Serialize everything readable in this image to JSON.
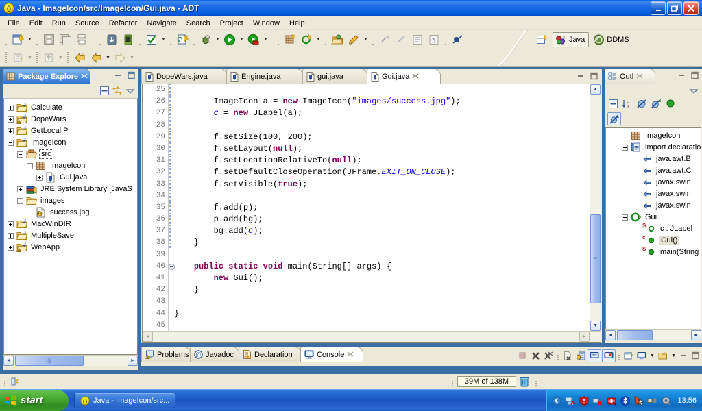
{
  "window": {
    "title": "Java - ImageIcon/src/ImageIcon/Gui.java - ADT",
    "app_icon": "eclipse-icon",
    "minimize_label": "Minimize",
    "restore_label": "Restore",
    "close_label": "Close"
  },
  "menu": [
    {
      "label": "File"
    },
    {
      "label": "Edit"
    },
    {
      "label": "Run"
    },
    {
      "label": "Source"
    },
    {
      "label": "Refactor"
    },
    {
      "label": "Navigate"
    },
    {
      "label": "Search"
    },
    {
      "label": "Project"
    },
    {
      "label": "Window"
    },
    {
      "label": "Help"
    }
  ],
  "perspective": {
    "open_label": "Open Perspective",
    "items": [
      {
        "label": "Java",
        "icon": "java-perspective-icon",
        "active": true
      },
      {
        "label": "DDMS",
        "icon": "ddms-perspective-icon",
        "active": false
      }
    ]
  },
  "package_explorer": {
    "tab_label": "Package Explore",
    "tab_icon": "package-explorer-icon",
    "toolbar": [
      {
        "name": "collapse-all-icon"
      },
      {
        "name": "link-with-editor-icon"
      },
      {
        "name": "view-menu-icon"
      }
    ],
    "tree": [
      {
        "label": "Calculate",
        "icon": "java-project-icon",
        "indent": 0,
        "expander": "plus"
      },
      {
        "label": "DopeWars",
        "icon": "java-project-warning-icon",
        "indent": 0,
        "expander": "plus"
      },
      {
        "label": "GetLocalIP",
        "icon": "java-project-icon",
        "indent": 0,
        "expander": "plus"
      },
      {
        "label": "ImageIcon",
        "icon": "java-project-icon",
        "indent": 0,
        "expander": "minus"
      },
      {
        "label": "src",
        "icon": "source-folder-icon",
        "indent": 1,
        "expander": "minus",
        "selected": true
      },
      {
        "label": "ImageIcon",
        "icon": "package-icon",
        "indent": 2,
        "expander": "minus"
      },
      {
        "label": "Gui.java",
        "icon": "java-file-icon",
        "indent": 3,
        "expander": "plus"
      },
      {
        "label": "JRE System Library [JavaS",
        "icon": "library-icon",
        "indent": 1,
        "expander": "plus"
      },
      {
        "label": "images",
        "icon": "folder-icon",
        "indent": 1,
        "expander": "minus"
      },
      {
        "label": "success.jpg",
        "icon": "image-file-icon",
        "indent": 2,
        "expander": "none"
      },
      {
        "label": "MacWinDIR",
        "icon": "java-project-icon",
        "indent": 0,
        "expander": "plus"
      },
      {
        "label": "MultipleSave",
        "icon": "java-project-icon",
        "indent": 0,
        "expander": "plus"
      },
      {
        "label": "WebApp",
        "icon": "java-project-warning-icon",
        "indent": 0,
        "expander": "plus"
      }
    ]
  },
  "editor": {
    "tabs": [
      {
        "label": "DopeWars.java",
        "icon": "java-file-icon",
        "active": false
      },
      {
        "label": "Engine.java",
        "icon": "java-file-icon",
        "active": false
      },
      {
        "label": "gui.java",
        "icon": "java-file-icon",
        "active": false
      },
      {
        "label": "Gui.java",
        "icon": "java-file-icon",
        "active": true,
        "closable": true
      }
    ],
    "first_line_number": 25,
    "last_line_number": 45,
    "lines": [
      {
        "n": 25,
        "text": "",
        "changed": true
      },
      {
        "n": 26,
        "text": "        ImageIcon a = new ImageIcon(\"images/success.jpg\");",
        "changed": true
      },
      {
        "n": 27,
        "text": "        c = new JLabel(a);",
        "changed": true
      },
      {
        "n": 28,
        "text": "",
        "changed": true
      },
      {
        "n": 29,
        "text": "        f.setSize(100, 200);",
        "changed": true
      },
      {
        "n": 30,
        "text": "        f.setLayout(null);",
        "changed": true
      },
      {
        "n": 31,
        "text": "        f.setLocationRelativeTo(null);",
        "changed": true
      },
      {
        "n": 32,
        "text": "        f.setDefaultCloseOperation(JFrame.EXIT_ON_CLOSE);",
        "changed": true
      },
      {
        "n": 33,
        "text": "        f.setVisible(true);",
        "changed": true
      },
      {
        "n": 34,
        "text": "",
        "changed": true
      },
      {
        "n": 35,
        "text": "        f.add(p);",
        "changed": true
      },
      {
        "n": 36,
        "text": "        p.add(bg);",
        "changed": true
      },
      {
        "n": 37,
        "text": "        bg.add(c);",
        "changed": true
      },
      {
        "n": 38,
        "text": "    }",
        "changed": true
      },
      {
        "n": 39,
        "text": "",
        "changed": false
      },
      {
        "n": 40,
        "text": "    public static void main(String[] args) {",
        "changed": false,
        "fold": true
      },
      {
        "n": 41,
        "text": "        new Gui();",
        "changed": false
      },
      {
        "n": 42,
        "text": "    }",
        "changed": false
      },
      {
        "n": 43,
        "text": "",
        "changed": false
      },
      {
        "n": 44,
        "text": "}",
        "changed": false
      },
      {
        "n": 45,
        "text": "",
        "changed": false
      }
    ]
  },
  "outline": {
    "tab_label": "Outl",
    "tab_icon": "outline-icon",
    "toolbar": [
      {
        "name": "collapse-all-icon"
      },
      {
        "name": "sort-alphabetically-icon"
      },
      {
        "name": "hide-fields-icon"
      },
      {
        "name": "hide-static-icon"
      },
      {
        "name": "hide-nonpublic-icon"
      },
      {
        "name": "hide-local-types-icon"
      },
      {
        "name": "view-menu-icon"
      }
    ],
    "tree": [
      {
        "label": "ImageIcon",
        "icon": "package-icon",
        "indent": 1,
        "expander": "none"
      },
      {
        "label": "import declaratio",
        "icon": "import-declarations-icon",
        "indent": 1,
        "expander": "minus"
      },
      {
        "label": "java.awt.B",
        "icon": "import-icon",
        "indent": 2,
        "expander": "none"
      },
      {
        "label": "java.awt.C",
        "icon": "import-icon",
        "indent": 2,
        "expander": "none"
      },
      {
        "label": "javax.swin",
        "icon": "import-icon",
        "indent": 2,
        "expander": "none"
      },
      {
        "label": "javax.swin",
        "icon": "import-icon",
        "indent": 2,
        "expander": "none"
      },
      {
        "label": "javax.swin",
        "icon": "import-icon",
        "indent": 2,
        "expander": "none"
      },
      {
        "label": "Gui",
        "icon": "class-icon",
        "indent": 1,
        "expander": "minus"
      },
      {
        "label": "c : JLabel",
        "icon": "field-private-static-icon",
        "indent": 2,
        "expander": "none",
        "modifier": "S"
      },
      {
        "label": "Gui()",
        "icon": "method-constructor-icon",
        "indent": 2,
        "expander": "none",
        "modifier": "c",
        "highlighted": true
      },
      {
        "label": "main(String",
        "icon": "method-static-icon",
        "indent": 2,
        "expander": "none",
        "modifier": "S"
      }
    ]
  },
  "bottom_panel": {
    "tabs": [
      {
        "label": "Problems",
        "icon": "problems-icon",
        "active": false
      },
      {
        "label": "Javadoc",
        "icon": "javadoc-icon",
        "active": false
      },
      {
        "label": "Declaration",
        "icon": "declaration-icon",
        "active": false
      },
      {
        "label": "Console",
        "icon": "console-icon",
        "active": true,
        "closable": true
      }
    ],
    "toolbar": [
      {
        "name": "terminate-icon"
      },
      {
        "name": "remove-launch-icon"
      },
      {
        "name": "remove-all-terminated-icon"
      },
      {
        "name": "clear-console-icon"
      },
      {
        "name": "scroll-lock-icon"
      },
      {
        "name": "pin-console-icon"
      },
      {
        "name": "display-selected-console-icon"
      },
      {
        "name": "new-console-view-icon"
      },
      {
        "name": "open-console-icon"
      },
      {
        "name": "minimize-icon"
      },
      {
        "name": "maximize-icon"
      }
    ]
  },
  "status": {
    "editor_state_icon": "writable-insert-icon",
    "memory_label": "39M of 138M",
    "gc_icon": "trash-icon"
  },
  "taskbar": {
    "start_label": "start",
    "items": [
      {
        "label": "Java - ImageIcon/src...",
        "icon": "eclipse-icon"
      }
    ],
    "tray_icons": [
      "show-hidden-icons",
      "network-disconnected-icon",
      "security-alert-icon",
      "wireless-disconnected-icon",
      "antivirus-alert-icon",
      "bluetooth-icon",
      "touchpad-icon",
      "power-icon",
      "volume-icon"
    ],
    "clock": "13:56"
  },
  "colors": {
    "title_blue": "#0a5fd4",
    "chrome": "#ece9d8",
    "tab_active": "#3a7fd5",
    "keyword": "#7f0055",
    "string": "#2a00ff",
    "field": "#0000c0",
    "taskbar": "#1b56c0"
  }
}
